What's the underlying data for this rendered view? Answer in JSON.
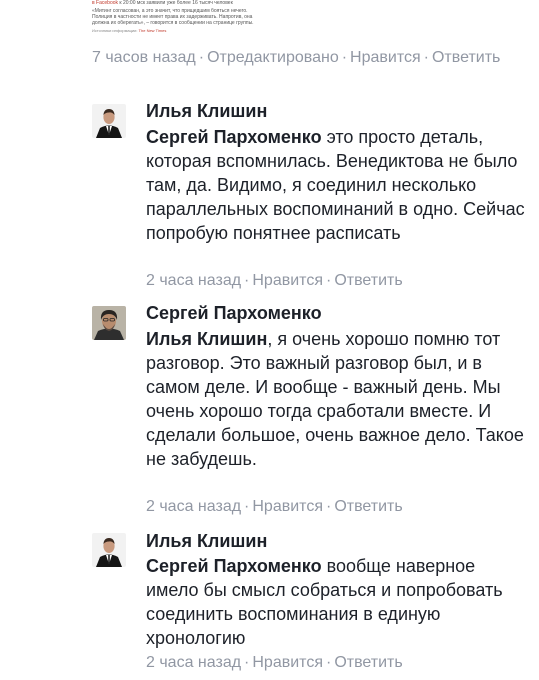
{
  "embed": {
    "line1_link": "в Facebook",
    "line1_rest": " к 20:00 мск заявили уже более 16 тысяч человек",
    "line2": "«Митинг согласован, а это значит, что прищедшим бояться нечего.",
    "line3": "Полиция в частности не имеет права их задерживать. Напротив, она",
    "line4": "должна их оберегать», – говорится в сообщении на странице группы.",
    "line5_prefix": "Источники информации: ",
    "line5_link": "The New Times"
  },
  "top_meta": {
    "time": "7 часов назад",
    "edited": "Отредактировано",
    "like": "Нравится",
    "reply": "Ответить"
  },
  "comments": [
    {
      "author": "Илья Клишин",
      "mention": "Сергей Пархоменко",
      "text": " это просто деталь, которая вспомнилась. Венедиктова не было там, да. Видимо, я соединил несколько параллельных воспоминаний в одно. Сейчас попробую понятнее расписать",
      "time": "2 часа назад",
      "like": "Нравится",
      "reply": "Ответить"
    },
    {
      "author": "Сергей Пархоменко",
      "mention": "Илья Клишин",
      "text": ", я очень хорошо помню тот разговор. Это важный разговор был, и в самом деле. И вообще - важный день. Мы очень хорошо тогда сработали вместе. И сделали большое, очень важное дело. Такое не забудешь.",
      "time": "2 часа назад",
      "like": "Нравится",
      "reply": "Ответить"
    },
    {
      "author": "Илья Клишин",
      "mention": "Сергей Пархоменко",
      "text": " вообще наверное имело бы смысл собраться и попробовать соединить воспоминания в единую хронологию",
      "time": "2 часа назад",
      "like": "Нравится",
      "reply": "Ответить"
    }
  ],
  "separator": "·"
}
